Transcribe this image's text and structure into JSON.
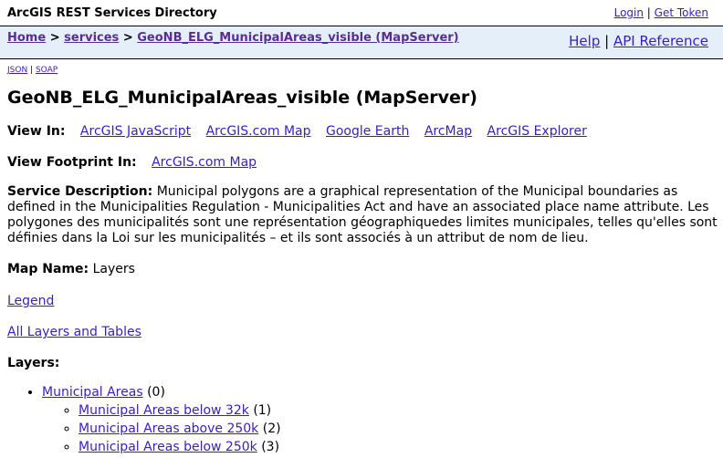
{
  "header": {
    "title": "ArcGIS REST Services Directory",
    "login": "Login",
    "get_token": "Get Token",
    "sep": " | "
  },
  "nav": {
    "home": "Home",
    "services": "services",
    "service": "GeoNB_ELG_MunicipalAreas_visible (MapServer)",
    "arrow": " > ",
    "help": "Help",
    "api_reference": "API Reference",
    "sep": " | "
  },
  "formats": {
    "json": "JSON",
    "soap": "SOAP",
    "sep": " | "
  },
  "page_title": "GeoNB_ELG_MunicipalAreas_visible (MapServer)",
  "view_in": {
    "label": "View In:",
    "links": [
      "ArcGIS JavaScript",
      "ArcGIS.com Map",
      "Google Earth",
      "ArcMap",
      "ArcGIS Explorer"
    ]
  },
  "view_footprint": {
    "label": "View Footprint In:",
    "link": "ArcGIS.com Map"
  },
  "service_description": {
    "label": "Service Description:",
    "text": "Municipal polygons are a graphical representation of the Municipal boundaries as defined in the Municipalities Regulation - Municipalities Act and have an associated place name attribute. Les polygones des municipalités sont une représentation géographiquedes limites municipales, telles qu'elles sont définies dans la Loi sur les municipalités – et ils sont associés à un attribut de nom de lieu."
  },
  "map_name": {
    "label": "Map Name:",
    "value": "Layers"
  },
  "legend_link": "Legend",
  "all_layers_link": "All Layers and Tables",
  "layers": {
    "label": "Layers:",
    "root": {
      "name": "Municipal Areas",
      "id": "(0)"
    },
    "children": [
      {
        "name": "Municipal Areas below 32k",
        "id": "(1)"
      },
      {
        "name": "Municipal Areas above 250k",
        "id": "(2)"
      },
      {
        "name": "Municipal Areas below 250k",
        "id": "(3)"
      }
    ]
  }
}
